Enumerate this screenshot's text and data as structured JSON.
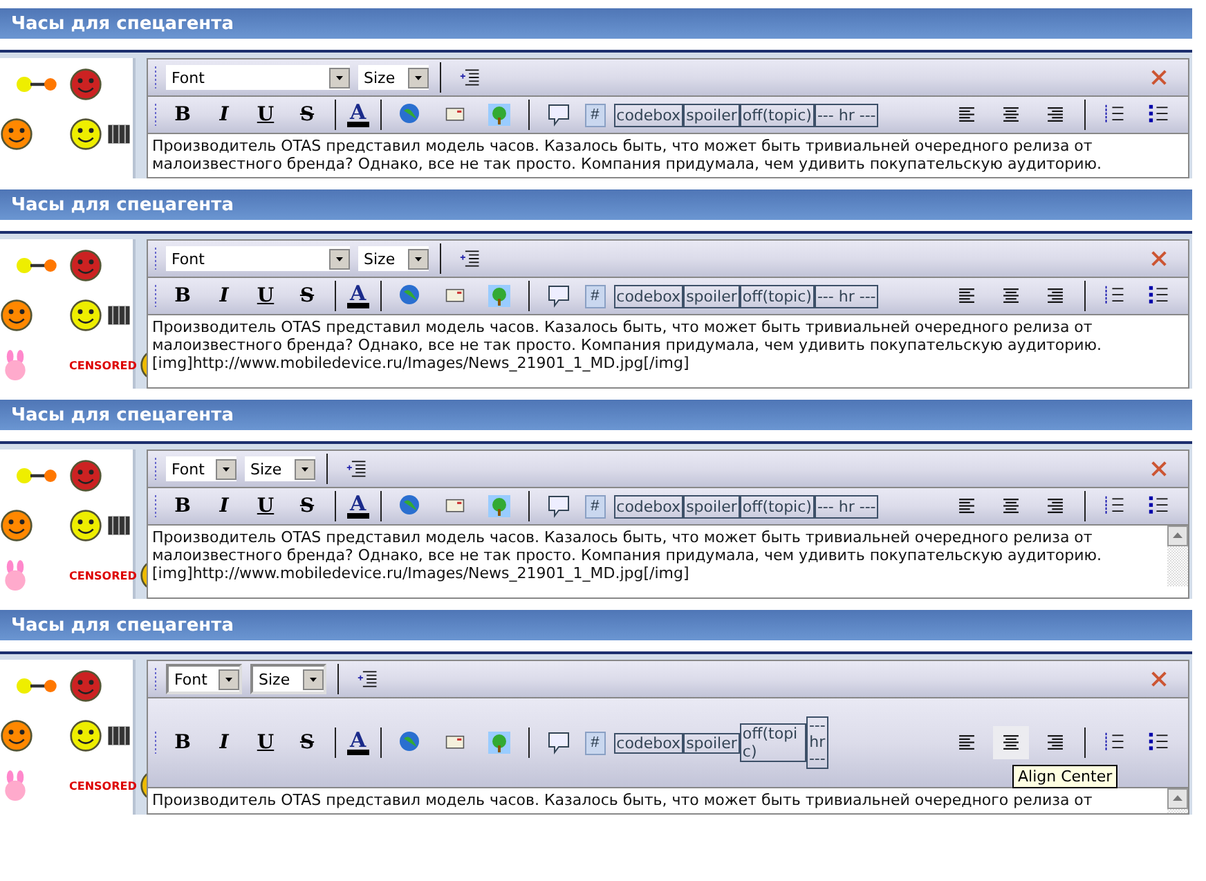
{
  "panels": [
    {
      "title": "Часы для спецагента",
      "compact_selects": false,
      "inset_selects": false,
      "font": "Font",
      "size": "Size",
      "format_buttons": [
        "B",
        "I",
        "U",
        "S"
      ],
      "color_button": "A",
      "hash_button": "#",
      "text_buttons": [
        "codebox",
        "spoiler",
        "off(topic)",
        "--- hr ---"
      ],
      "wrapped_buttons": false,
      "align_buttons": [
        {
          "hovered": false
        },
        {
          "hovered": false
        },
        {
          "hovered": false
        }
      ],
      "scrollbar": false,
      "text": [
        "Производитель OTAS представил модель часов. Казалось быть, что может быть тривиальней очередного релиза от",
        "малоизвестного бренда? Однако, все не так просто. Компания придумала, чем удивить покупательскую аудиторию."
      ]
    },
    {
      "title": "Часы для спецагента",
      "compact_selects": false,
      "inset_selects": false,
      "font": "Font",
      "size": "Size",
      "format_buttons": [
        "B",
        "I",
        "U",
        "S"
      ],
      "color_button": "A",
      "hash_button": "#",
      "text_buttons": [
        "codebox",
        "spoiler",
        "off(topic)",
        "--- hr ---"
      ],
      "wrapped_buttons": false,
      "align_buttons": [
        {
          "hovered": false
        },
        {
          "hovered": false
        },
        {
          "hovered": false
        }
      ],
      "scrollbar": false,
      "censored": "CENSORED",
      "text": [
        "Производитель OTAS представил модель часов. Казалось быть, что может быть тривиальней очередного релиза от",
        "малоизвестного бренда? Однако, все не так просто. Компания придумала, чем удивить покупательскую аудиторию.",
        "[img]http://www.mobiledevice.ru/Images/News_21901_1_MD.jpg[/img]"
      ]
    },
    {
      "title": "Часы для спецагента",
      "compact_selects": true,
      "inset_selects": false,
      "font": "Font",
      "size": "Size",
      "format_buttons": [
        "B",
        "I",
        "U",
        "S"
      ],
      "color_button": "A",
      "hash_button": "#",
      "text_buttons": [
        "codebox",
        "spoiler",
        "off(topic)",
        "--- hr ---"
      ],
      "wrapped_buttons": false,
      "align_buttons": [
        {
          "hovered": false
        },
        {
          "hovered": false
        },
        {
          "hovered": false
        }
      ],
      "scrollbar": true,
      "censored": "CENSORED",
      "text": [
        "Производитель OTAS представил модель часов. Казалось быть, что может быть тривиальней очередного релиза от",
        "малоизвестного бренда? Однако, все не так просто. Компания придумала, чем удивить покупательскую аудиторию.",
        "[img]http://www.mobiledevice.ru/Images/News_21901_1_MD.jpg[/img]"
      ]
    },
    {
      "title": "Часы для спецагента",
      "compact_selects": true,
      "inset_selects": true,
      "font": "Font",
      "size": "Size",
      "format_buttons": [
        "B",
        "I",
        "U",
        "S"
      ],
      "color_button": "A",
      "hash_button": "#",
      "text_buttons": [
        "codebox",
        "spoiler",
        "off(topic)",
        "--- hr ---"
      ],
      "wrapped_buttons": true,
      "align_buttons": [
        {
          "hovered": false
        },
        {
          "hovered": true,
          "tooltip": "Align Center"
        },
        {
          "hovered": false
        }
      ],
      "scrollbar": true,
      "censored": "CENSORED",
      "text": [
        "Производитель OTAS представил модель часов. Казалось быть, что может быть тривиальней очередного релиза от"
      ]
    }
  ]
}
